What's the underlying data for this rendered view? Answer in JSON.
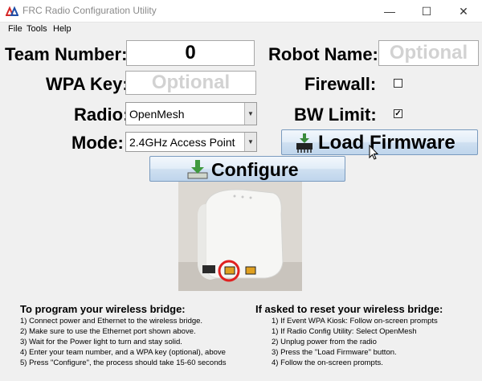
{
  "window": {
    "title": "FRC Radio Configuration Utility",
    "minimize": "—",
    "maximize": "☐",
    "close": "✕"
  },
  "menu": [
    "File",
    "Tools",
    "Help"
  ],
  "form": {
    "team_number": {
      "label": "Team Number:",
      "value": "0"
    },
    "robot_name": {
      "label": "Robot Name:",
      "placeholder": "Optional"
    },
    "wpa_key": {
      "label": "WPA Key:",
      "placeholder": "Optional"
    },
    "firewall": {
      "label": "Firewall:",
      "checked": false
    },
    "radio": {
      "label": "Radio:",
      "value": "OpenMesh"
    },
    "bw_limit": {
      "label": "BW Limit:",
      "checked": true,
      "mark": "✓"
    },
    "mode": {
      "label": "Mode:",
      "value": "2.4GHz Access Point"
    }
  },
  "buttons": {
    "load_firmware": "Load Firmware",
    "configure": "Configure"
  },
  "instructions": {
    "program": {
      "heading": "To program your wireless bridge:",
      "steps": [
        "1) Connect power and Ethernet to the wireless bridge.",
        "2) Make sure to use the Ethernet port shown above.",
        "3) Wait for the Power light to turn and stay solid.",
        "4) Enter your team number, and a WPA key (optional), above",
        "5) Press \"Configure\", the process should take 15-60 seconds"
      ]
    },
    "reset": {
      "heading": "If asked to reset your wireless bridge:",
      "steps": [
        "1) If Event WPA Kiosk: Follow on-screen prompts",
        "1) If Radio Config Utility: Select OpenMesh",
        "2) Unplug power from the radio",
        "3) Press the \"Load Firmware\" button.",
        "4) Follow the on-screen prompts."
      ]
    }
  },
  "colors": {
    "accent_red": "#e02020",
    "button_border": "#7a9bbf",
    "window_bg": "#f0f0f0"
  },
  "icons": {
    "app": "frc-logo-icon",
    "firmware": "chip-download-icon",
    "configure": "download-arrow-icon"
  }
}
